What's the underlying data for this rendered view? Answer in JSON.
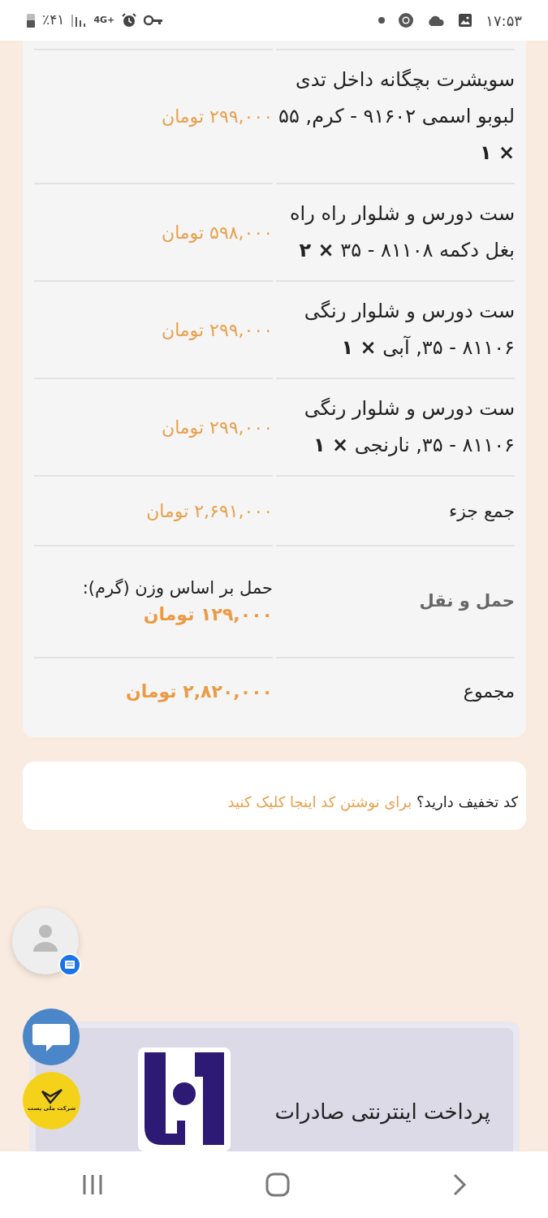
{
  "status_bar": {
    "battery": "٪۴۱",
    "network": "4G+",
    "time": "۱۷:۵۳"
  },
  "order_table": {
    "items": [
      {
        "name": "سویشرت بچگانه داخل تدی لبوبو اسمی ۹۱۶۰۲ - کرم, ۵۵",
        "quantity": "× ۱",
        "price": "۲۹۹,۰۰۰ تومان"
      },
      {
        "name": "ست دورس و شلوار راه راه بغل دکمه ۸۱۱۰۸ - ۳۵",
        "quantity": "× ۲",
        "price": "۵۹۸,۰۰۰ تومان"
      },
      {
        "name": "ست دورس و شلوار رنگی ۸۱۱۰۶ - ۳۵, آبی",
        "quantity": "× ۱",
        "price": "۲۹۹,۰۰۰ تومان"
      },
      {
        "name": "ست دورس و شلوار رنگی ۸۱۱۰۶ - ۳۵, نارنجی",
        "quantity": "× ۱",
        "price": "۲۹۹,۰۰۰ تومان"
      }
    ],
    "subtotal": {
      "label": "جمع جزء",
      "value": "۲,۶۹۱,۰۰۰ تومان"
    },
    "shipping": {
      "label": "حمل و نقل",
      "method": "حمل بر اساس وزن (گرم):",
      "value": "۱۲۹,۰۰۰ تومان"
    },
    "total": {
      "label": "مجموع",
      "value": "۲,۸۲۰,۰۰۰ تومان"
    }
  },
  "coupon": {
    "question": "کد تخفیف دارید؟",
    "link": "برای نوشتن کد اینجا کلیک کنید"
  },
  "post_badge": {
    "text": "شرکت ملی پست"
  },
  "payment": {
    "title": "پرداخت اینترنتی صادرات"
  }
}
